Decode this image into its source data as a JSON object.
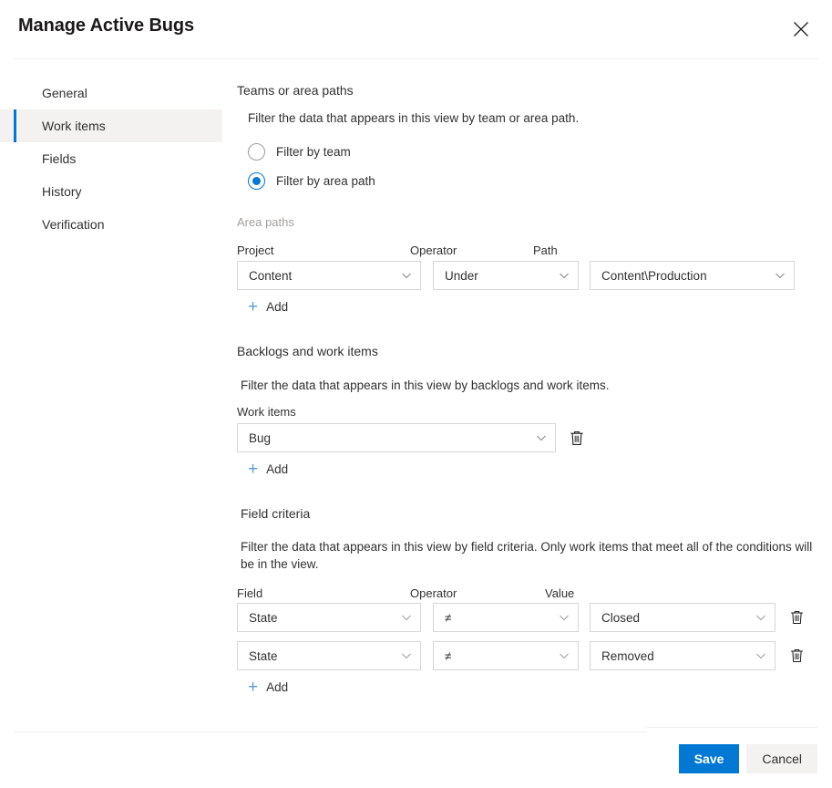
{
  "header": {
    "title": "Manage Active Bugs",
    "close_icon": "close-icon"
  },
  "sidebar": {
    "items": [
      {
        "label": "General",
        "selected": false
      },
      {
        "label": "Work items",
        "selected": true
      },
      {
        "label": "Fields",
        "selected": false
      },
      {
        "label": "History",
        "selected": false
      },
      {
        "label": "Verification",
        "selected": false
      }
    ]
  },
  "main": {
    "teams_section": {
      "title": "Teams or area paths",
      "description": "Filter the data that appears in this view by team or area path.",
      "radios": [
        {
          "label": "Filter by team",
          "checked": false
        },
        {
          "label": "Filter by area path",
          "checked": true
        }
      ]
    },
    "area_paths": {
      "group_label": "Area paths",
      "columns": [
        "Project",
        "Operator",
        "Path"
      ],
      "rows": [
        {
          "project": "Content",
          "operator": "Under",
          "path": "Content\\Production"
        }
      ],
      "add_label": "Add",
      "add_plus": "+"
    },
    "backlogs_section": {
      "title": "Backlogs and work items",
      "description": "Filter the data that appears in this view by backlogs and work items.",
      "field_label": "Work items",
      "rows": [
        {
          "value": "Bug",
          "delete_icon": "trash-icon"
        }
      ],
      "add_label": "Add",
      "add_plus": "+"
    },
    "field_criteria": {
      "title": "Field criteria",
      "description": "Filter the data that appears in this view by field criteria. Only work items that meet all of the conditions will be in the view.",
      "columns": [
        "Field",
        "Operator",
        "Value"
      ],
      "rows": [
        {
          "field": "State",
          "operator": "≠",
          "value": "Closed",
          "delete_icon": "trash-icon"
        },
        {
          "field": "State",
          "operator": "≠",
          "value": "Removed",
          "delete_icon": "trash-icon"
        }
      ],
      "add_label": "Add",
      "add_plus": "+"
    }
  },
  "footer": {
    "save_label": "Save",
    "cancel_label": "Cancel"
  },
  "colors": {
    "accent": "#0078d4",
    "selected_nav_bg": "#f3f2f1",
    "border": "#d6d6d6",
    "divider": "#ededed",
    "add_plus": "#5a9bd5",
    "muted_text": "#a19f9d"
  }
}
